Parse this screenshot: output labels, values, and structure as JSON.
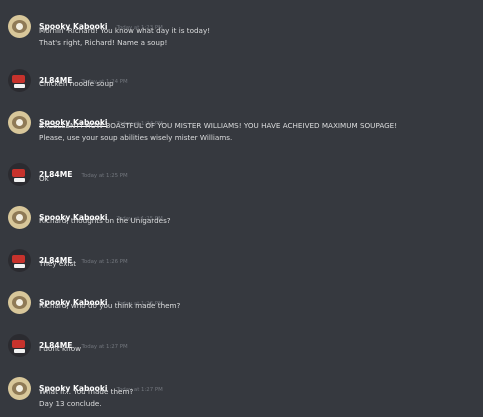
{
  "messages": [
    {
      "author": "Spooky Kabooki",
      "time": "Today at 1:23 PM",
      "lines": [
        "Mornin' Richard! You know what day it is today!",
        "That's right, Richard! Name a soup!"
      ]
    },
    {
      "author": "2L84ME",
      "time": "Today at 1:24 PM",
      "lines": [
        "Chicken noodle soup"
      ]
    },
    {
      "author": "Spooky Kabooki",
      "time": "Today at 1:24 PM",
      "lines": [
        "EXCELLENT! HOW BOASTFUL OF YOU MISTER WILLIAMS! YOU HAVE ACHEIVED MAXIMUM SOUPAGE!",
        "Please, use your soup abilities wisely mister Williams."
      ]
    },
    {
      "author": "2L84ME",
      "time": "Today at 1:25 PM",
      "lines": [
        "Ok"
      ]
    },
    {
      "author": "Spooky Kabooki",
      "time": "Today at 1:25 PM",
      "lines": [
        "Richard, thoughts on the Unigardes?"
      ]
    },
    {
      "author": "2L84ME",
      "time": "Today at 1:26 PM",
      "lines": [
        "They exist"
      ]
    },
    {
      "author": "Spooky Kabooki",
      "time": "Today at 1:26 PM",
      "lines": [
        "Richard, who do you think made them?"
      ]
    },
    {
      "author": "2L84ME",
      "time": "Today at 1:27 PM",
      "lines": [
        "I dont know"
      ]
    },
    {
      "author": "Spooky Kabooki",
      "time": "Today at 1:27 PM",
      "lines": [
        "What if... You made them?",
        "Day 13 conclude."
      ]
    }
  ]
}
